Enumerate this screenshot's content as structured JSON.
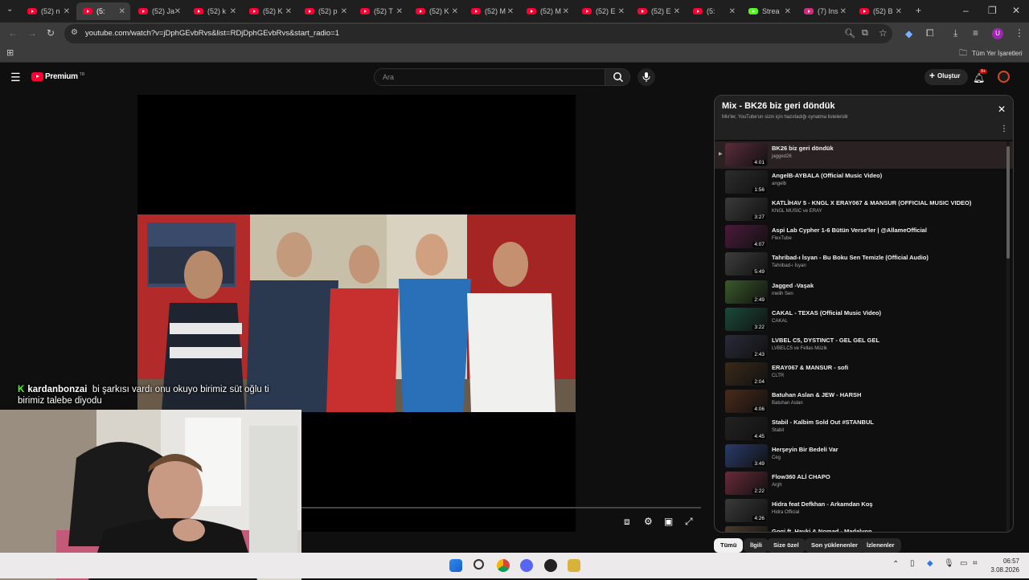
{
  "browser": {
    "tabs": [
      {
        "label": "(52) n"
      },
      {
        "label": "(5:"
      },
      {
        "label": "(52) Ja"
      },
      {
        "label": "(52) k"
      },
      {
        "label": "(52) K"
      },
      {
        "label": "(52) p"
      },
      {
        "label": "(52) T"
      },
      {
        "label": "(52) K"
      },
      {
        "label": "(52) M"
      },
      {
        "label": "(52) M"
      },
      {
        "label": "(52) E"
      },
      {
        "label": "(52) E"
      },
      {
        "label": "(5:"
      },
      {
        "label": "Strea"
      },
      {
        "label": "(7) Ins"
      },
      {
        "label": "(52) B"
      }
    ],
    "url": "youtube.com/watch?v=jDphGEvbRvs&list=RDjDphGEvbRvs&start_radio=1",
    "bookmarks_label": "Tüm Yer İşaretleri"
  },
  "youtube": {
    "logo_text": "Premium",
    "logo_region": "TR",
    "search_placeholder": "Ara",
    "create_label": "Oluştur",
    "notif_count": "9+"
  },
  "chat": {
    "username": "kardanbonzai",
    "message": "bi şarkısı vardı onu okuyo birimiz süt oğlu ti birimiz talebe diyodu"
  },
  "playlist": {
    "title": "Mix - BK26 biz geri döndük",
    "subtitle": "Mix'ler, YouTube'un sizin için hazırladığı oynatma listeleridir",
    "items": [
      {
        "title": "BK26 biz geri döndük",
        "channel": "jagged26",
        "duration": "4:01",
        "color": "#5a2c3c"
      },
      {
        "title": "AngelB-AYBALA (Official Music Video)",
        "channel": "angelb",
        "duration": "1:56",
        "color": "#2c2c2c"
      },
      {
        "title": "KATLİHAV 5 - KNGL X ERAY067 & MANSUR (OFFICIAL MUSIC VIDEO)",
        "channel": "KNGL MUSIC ve ERAY",
        "duration": "3:27",
        "color": "#3a3a3a"
      },
      {
        "title": "Aspi Lab Cypher 1-6 Bütün Verse'ler | @AllameOfficial",
        "channel": "FlexTube",
        "duration": "4:07",
        "color": "#4a1a3a"
      },
      {
        "title": "Tahribad-ı İsyan - Bu Boku Sen Temizle (Official Audio)",
        "channel": "Tahribad-ı İsyan",
        "duration": "5:49",
        "color": "#3d3d3d"
      },
      {
        "title": "Jagged -Vaşak",
        "channel": "melih Sen",
        "duration": "2:49",
        "color": "#3a5a2a"
      },
      {
        "title": "CAKAL - TEXAS (Official Music Video)",
        "channel": "CAKAL",
        "duration": "3:22",
        "color": "#1a4a3a"
      },
      {
        "title": "LVBEL C5, DYSTINCT - GEL GEL GEL",
        "channel": "LVBELC5 ve Fellas Müzik",
        "duration": "2:43",
        "color": "#2a2a3a"
      },
      {
        "title": "ERAY067 & MANSUR - sofi",
        "channel": "CLTR",
        "duration": "2:04",
        "color": "#3a2a1a"
      },
      {
        "title": "Batuhan Aslan & JEW - HARSH",
        "channel": "Batuhan Aslan",
        "duration": "4:06",
        "color": "#4a2a1a"
      },
      {
        "title": "Stabil - Kalbim Sold Out #STANBUL",
        "channel": "Stabil",
        "duration": "4:45",
        "color": "#222222"
      },
      {
        "title": "Herşeyin Bir Bedeli Var",
        "channel": "Ceg",
        "duration": "3:49",
        "color": "#2a3a6a"
      },
      {
        "title": "Flow360 ALİ CHAPO",
        "channel": "Argh",
        "duration": "2:22",
        "color": "#6a2a3a"
      },
      {
        "title": "Hidra feat Defkhan - Arkamdan Koş",
        "channel": "Hidra Official",
        "duration": "4:26",
        "color": "#3a3a3a"
      },
      {
        "title": "Gogi ft. Hayki & Nomad - Madalyon",
        "channel": "",
        "duration": "",
        "color": "#4a3a2a"
      }
    ]
  },
  "chips": [
    {
      "label": "Tümü"
    },
    {
      "label": "İlgili"
    },
    {
      "label": "Size özel"
    },
    {
      "label": "Son yüklenenler"
    },
    {
      "label": "İzlenenler"
    }
  ],
  "taskbar": {
    "time": "06:57",
    "date": "3.08.2026"
  }
}
